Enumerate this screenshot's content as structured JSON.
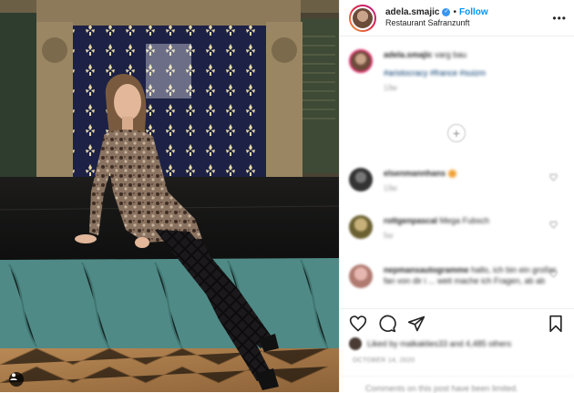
{
  "header": {
    "username": "adela.smajic",
    "verified_mark": "✓",
    "separator": "•",
    "follow_label": "Follow",
    "location": "Restaurant Safranzunft",
    "more_icon": "more-horizontal-icon"
  },
  "caption": {
    "username": "adela.smajic",
    "text": "varg bau",
    "hashtags": "#aristocracy #france #suizm",
    "time": "13w"
  },
  "load_more_symbol": "+",
  "comments": [
    {
      "username": "elsenmannhans",
      "text": "",
      "time": "13w"
    },
    {
      "username": "rottgenpascal",
      "text": "Mega Fubsch",
      "time": "5w"
    },
    {
      "username": "nepmansautogramme",
      "text": "hallo, ich bin ein großer fan von dir i ... weit mache ich Fragen, ab ab",
      "time": ""
    }
  ],
  "actions": {
    "like_icon": "heart-icon",
    "comment_icon": "comment-icon",
    "share_icon": "send-icon",
    "save_icon": "bookmark-icon"
  },
  "likes_text": "Liked by malkaklies33 and 4,485 others",
  "date": "OCTOBER 14, 2020",
  "comments_limited": "Comments on this post have been limited.",
  "colors": {
    "accent": "#0095f6",
    "verified": "#3897f0",
    "muted": "#8e8e8e",
    "border": "#efefef"
  }
}
